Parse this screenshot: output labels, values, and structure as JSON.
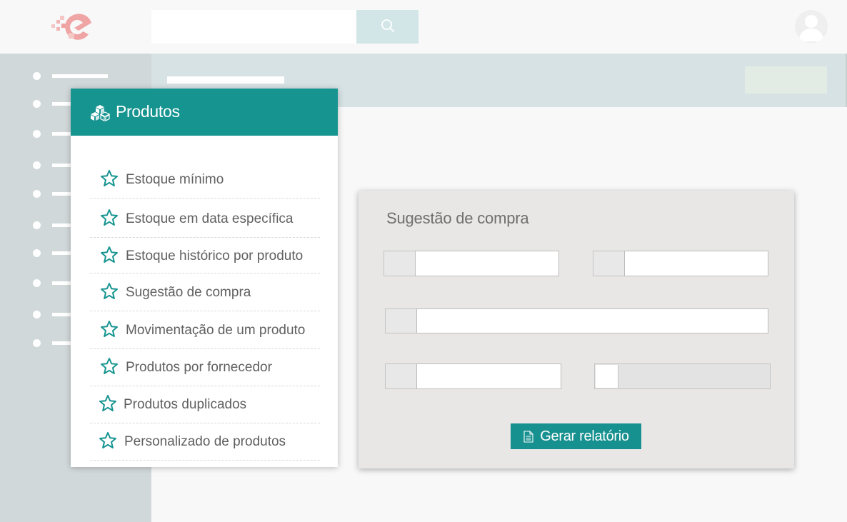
{
  "header": {
    "search": {
      "placeholder": "",
      "value": ""
    },
    "icons": {
      "logo": "brand-logo-icon",
      "search": "search-icon",
      "avatar": "user-avatar-icon"
    }
  },
  "products_menu": {
    "title": "Produtos",
    "icon": "cubes-icon",
    "items": [
      {
        "label": "Estoque mínimo"
      },
      {
        "label": "Estoque em data específica"
      },
      {
        "label": "Estoque histórico por produto"
      },
      {
        "label": "Sugestão de compra"
      },
      {
        "label": "Movimentação de um produto"
      },
      {
        "label": "Produtos por fornecedor"
      },
      {
        "label": "Produtos duplicados"
      },
      {
        "label": "Personalizado de produtos"
      }
    ]
  },
  "report": {
    "title": "Sugestão de compra",
    "fields": [
      {
        "value": ""
      },
      {
        "value": ""
      },
      {
        "value": ""
      },
      {
        "value": ""
      }
    ],
    "checkbox_checked": false,
    "generate_label": "Gerar relatório"
  },
  "colors": {
    "teal": "#169490",
    "sidebar": "#d1d8d9",
    "band": "#d6e2e4",
    "card": "#e8e7e5"
  }
}
